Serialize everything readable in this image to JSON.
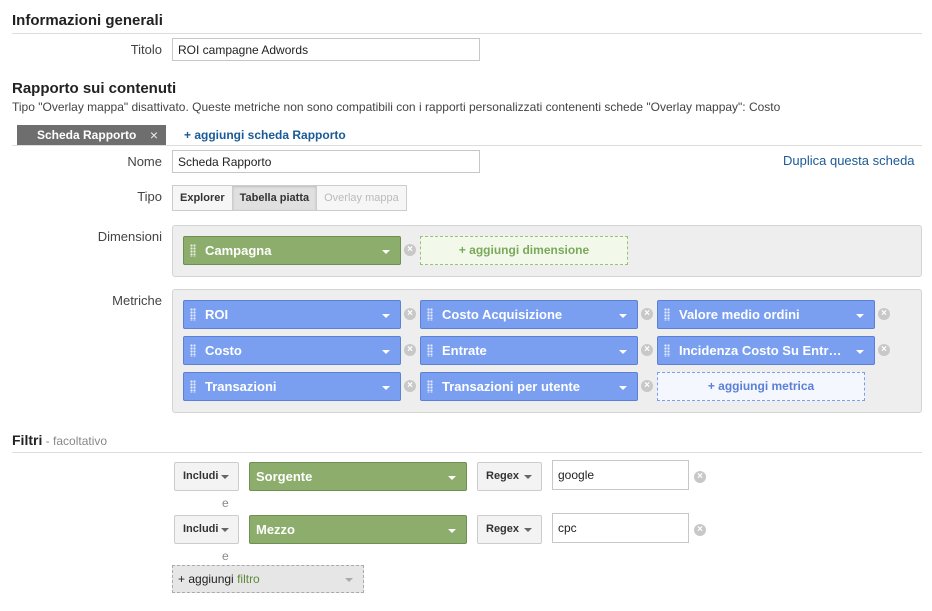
{
  "general": {
    "title": "Informazioni generali",
    "title_label": "Titolo",
    "title_value": "ROI campagne Adwords"
  },
  "content": {
    "title": "Rapporto sui contenuti",
    "notice": "Tipo \"Overlay mappa\" disattivato. Queste metriche non sono compatibili con i rapporti personalizzati contenenti schede \"Overlay mappay\": Costo",
    "tab_label": "Scheda Rapporto",
    "tab_close": "×",
    "add_tab": "+ aggiungi scheda Rapporto",
    "name_label": "Nome",
    "name_value": "Scheda Rapporto",
    "duplicate": "Duplica questa scheda",
    "type_label": "Tipo",
    "types": [
      "Explorer",
      "Tabella piatta",
      "Overlay mappa"
    ],
    "dimensions_label": "Dimensioni",
    "dimension": "Campagna",
    "add_dimension": "+ aggiungi dimensione",
    "metrics_label": "Metriche",
    "metrics": [
      "ROI",
      "Costo Acquisizione",
      "Valore medio ordini",
      "Costo",
      "Entrate",
      "Incidenza Costo Su Entr…",
      "Transazioni",
      "Transazioni per utente"
    ],
    "add_metric": "+ aggiungi metrica",
    "remove_symbol": "×"
  },
  "filters": {
    "title": "Filtri",
    "optional": " - facoltativo",
    "rows": [
      {
        "include": "Includi",
        "field": "Sorgente",
        "match": "Regex",
        "value": "google"
      },
      {
        "include": "Includi",
        "field": "Mezzo",
        "match": "Regex",
        "value": "cpc"
      }
    ],
    "and_label": "e",
    "add_prefix": "+ aggiungi ",
    "add_word": "filtro"
  },
  "colors": {
    "dimension_pill": "#8cad6b",
    "metric_pill": "#7a9ff0",
    "link": "#1a5a96"
  }
}
